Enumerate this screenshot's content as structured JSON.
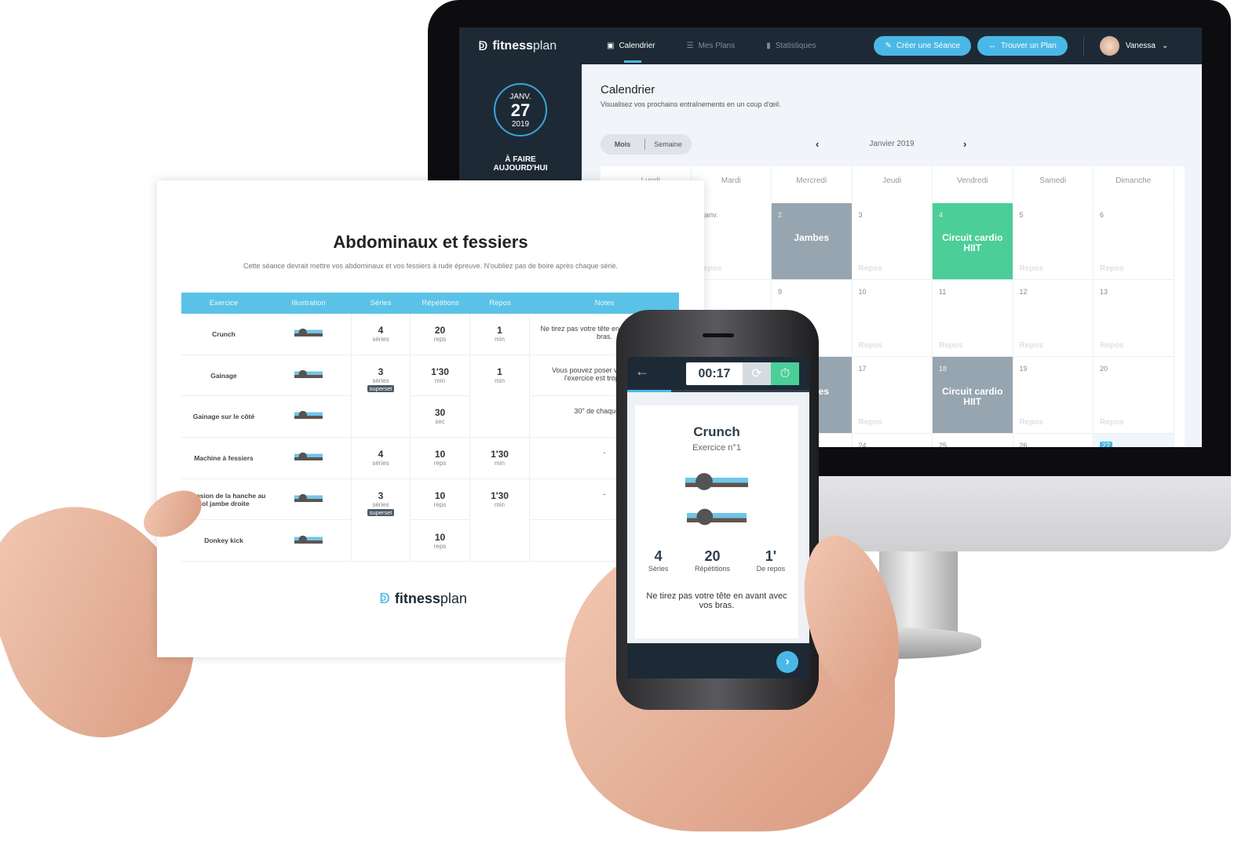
{
  "desktop": {
    "logo": {
      "bold": "fitness",
      "light": "plan"
    },
    "nav": [
      {
        "label": "Calendrier",
        "icon": "calendar-icon",
        "active": true
      },
      {
        "label": "Mes Plans",
        "icon": "list-icon"
      },
      {
        "label": "Statistiques",
        "icon": "bar-chart-icon"
      }
    ],
    "buttons": {
      "create": "Créer une Séance",
      "find": "Trouver un Plan"
    },
    "user": "Vanessa",
    "sidebar": {
      "month": "JANV.",
      "day": "27",
      "year": "2019",
      "todo_line1": "À FAIRE",
      "todo_line2": "AUJOURD'HUI"
    },
    "page": {
      "title": "Calendrier",
      "subtitle": "Visualisez vos prochains entraînements en un coup d'œil."
    },
    "view_toggle": {
      "month": "Mois",
      "week": "Semaine"
    },
    "month_label": "Janvier 2019",
    "weekdays": [
      "Lundi",
      "Mardi",
      "Mercredi",
      "Jeudi",
      "Vendredi",
      "Samedi",
      "Dimanche"
    ],
    "rest_label": "Repos",
    "weeks": [
      [
        {
          "n": ""
        },
        {
          "n": "1 janv."
        },
        {
          "n": "2",
          "event": "Jambes",
          "color": "#97a5b1"
        },
        {
          "n": "3"
        },
        {
          "n": "4",
          "event": "Circuit cardio HIIT",
          "color": "#4bce97"
        },
        {
          "n": "5"
        },
        {
          "n": "6"
        }
      ],
      [
        {
          "n": ""
        },
        {
          "n": ""
        },
        {
          "n": "9"
        },
        {
          "n": "10"
        },
        {
          "n": "11"
        },
        {
          "n": "12"
        },
        {
          "n": "13"
        }
      ],
      [
        {
          "n": ""
        },
        {
          "n": ""
        },
        {
          "n": "",
          "event": "Jambes",
          "color": "#97a5b1"
        },
        {
          "n": "17"
        },
        {
          "n": "18",
          "event": "Circuit cardio HIIT",
          "color": "#97a5b1"
        },
        {
          "n": "19"
        },
        {
          "n": "20"
        }
      ],
      [
        {
          "n": ""
        },
        {
          "n": ""
        },
        {
          "n": ""
        },
        {
          "n": "24"
        },
        {
          "n": "25"
        },
        {
          "n": "26"
        },
        {
          "n": "27",
          "today": true
        }
      ]
    ],
    "colors": {
      "nav_bg": "#1d2a36",
      "accent": "#4ab8e6",
      "green": "#4bce97",
      "gray_event": "#97a5b1"
    }
  },
  "paper": {
    "title": "Abdominaux et fessiers",
    "subtitle": "Cette séance devrait mettre vos abdominaux et vos fessiers à rude épreuve. N'oubliez pas de boire après chaque série.",
    "columns": [
      "Exercice",
      "Illustration",
      "Séries",
      "Répétitions",
      "Repos",
      "Notes"
    ],
    "rows": [
      {
        "name": "Crunch",
        "series": "4",
        "series_unit": "séries",
        "reps": "20",
        "reps_unit": "reps",
        "rest": "1",
        "rest_unit": "min",
        "note": "Ne tirez pas votre tête en avant avec vos bras."
      },
      {
        "name": "Gainage",
        "series": "3",
        "series_unit": "séries",
        "superset": "superset",
        "reps": "1'30",
        "reps_unit": "min",
        "rest": "1",
        "rest_unit": "min",
        "note": "Vous pouvez poser vos genoux si l'exercice est trop difficile."
      },
      {
        "name": "Gainage sur le côté",
        "reps": "30",
        "reps_unit": "sec",
        "note": "30\" de chaque côté"
      },
      {
        "name": "Machine à fessiers",
        "series": "4",
        "series_unit": "séries",
        "reps": "10",
        "reps_unit": "reps",
        "rest": "1'30",
        "rest_unit": "min",
        "note": "-"
      },
      {
        "name": "Extension de la hanche au sol jambe droite",
        "series": "3",
        "series_unit": "séries",
        "superset": "superset",
        "reps": "10",
        "reps_unit": "reps",
        "rest": "1'30",
        "rest_unit": "min",
        "note": "-"
      },
      {
        "name": "Donkey kick",
        "reps": "10",
        "reps_unit": "reps",
        "note": ""
      }
    ],
    "footer_logo": {
      "bold": "fitness",
      "light": "plan"
    }
  },
  "phone": {
    "timer": "00:17",
    "exercise": "Crunch",
    "exercise_number": "Exercice n°1",
    "stats": [
      {
        "value": "4",
        "label": "Séries"
      },
      {
        "value": "20",
        "label": "Répétitions"
      },
      {
        "value": "1'",
        "label": "De repos"
      }
    ],
    "note": "Ne tirez pas votre tête en avant avec vos bras."
  }
}
